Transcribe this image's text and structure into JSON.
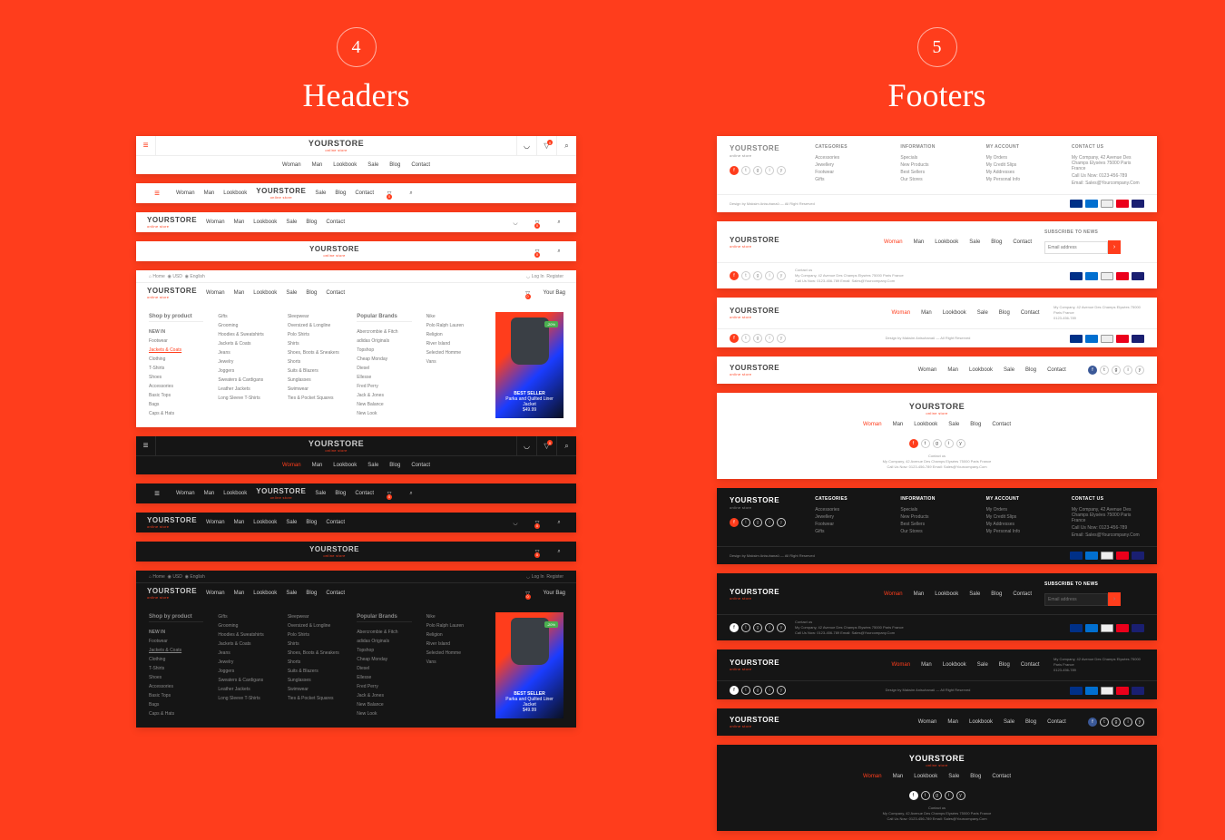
{
  "sections": {
    "headers": {
      "num": "4",
      "title": "Headers"
    },
    "footers": {
      "num": "5",
      "title": "Footers"
    }
  },
  "brand": {
    "name": "YOURSTORE",
    "sub": "online store"
  },
  "nav": {
    "woman": "Woman",
    "man": "Man",
    "lookbook": "Lookbook",
    "sale": "Sale",
    "blog": "Blog",
    "contact": "Contact"
  },
  "topbar": {
    "home": "Home",
    "usd": "USD",
    "en": "English",
    "login": "Log In",
    "register": "Register"
  },
  "bag": {
    "count": "0",
    "label": "Your Bag"
  },
  "mega": {
    "head1": "Shop by product",
    "head2": "Popular Brands",
    "c1": [
      "NEW IN",
      "Footwear",
      "Jackets & Coats",
      "Clothing",
      "T-Shirts",
      "Shoes",
      "Accessories",
      "Basic Tops",
      "Bags",
      "Caps & Hats"
    ],
    "c2": [
      "Gifts",
      "Grooming",
      "Hoodies & Sweatshirts",
      "Jackets & Coats",
      "Jeans",
      "Jewelry",
      "Joggers",
      "Sweaters & Cardigans",
      "Leather Jackets",
      "Long Sleeve T-Shirts"
    ],
    "c3": [
      "Sleepwear",
      "Oversized & Longline",
      "Polo Shirts",
      "Shirts",
      "Shoes, Boots & Sneakers",
      "Shorts",
      "Suits & Blazers",
      "Sunglasses",
      "Swimwear",
      "Ties & Pocket Squares"
    ],
    "c4": [
      "Abercrombie & Fitch",
      "adidas Originals",
      "Topshop",
      "Cheap Monday",
      "Diesel",
      "Ellesse",
      "Fred Perry",
      "Jack & Jones",
      "New Balance",
      "New Look"
    ],
    "c5": [
      "Nike",
      "Polo Ralph Lauren",
      "Religion",
      "River Island",
      "Selected Homme",
      "Vans"
    ],
    "promo": {
      "badge": "BEST SELLER",
      "name": "Parka and Quilted Liner Jacket",
      "price": "$49.99",
      "tag": "-20%"
    }
  },
  "footer": {
    "cols": {
      "cat": {
        "h": "CATEGORIES",
        "i": [
          "Accessories",
          "Jewellery",
          "Footwear",
          "Gifts"
        ]
      },
      "info": {
        "h": "INFORMATION",
        "i": [
          "Specials",
          "New Products",
          "Best Sellers",
          "Our Stores"
        ]
      },
      "acc": {
        "h": "MY ACCOUNT",
        "i": [
          "My Orders",
          "My Credit Slips",
          "My Addresses",
          "My Personal Info"
        ]
      },
      "con": {
        "h": "CONTACT US",
        "i": [
          "My Company, 42 Avenue Des Champs Elysées 75000 Paris France",
          "Call Us Now: 0123-456-789",
          "Email: Sales@Yourcompany.Com"
        ]
      }
    },
    "copy": "Design by Maksim Anisuhanaŭ — All Right Reserved",
    "sub": {
      "h": "SUBSCRIBE TO NEWS",
      "ph": "Email address"
    },
    "contact_inline": "Contact us\nMy Company, 42 Avenue Des Champs Elysées 75000 Paris France\nCall Us Now: 0123-456-789 Email: Sales@Yourcompany.Com",
    "addr": "My Company, 42 Avenue Des Champs Elysées 75000 Paris France\n0123-456-789"
  }
}
